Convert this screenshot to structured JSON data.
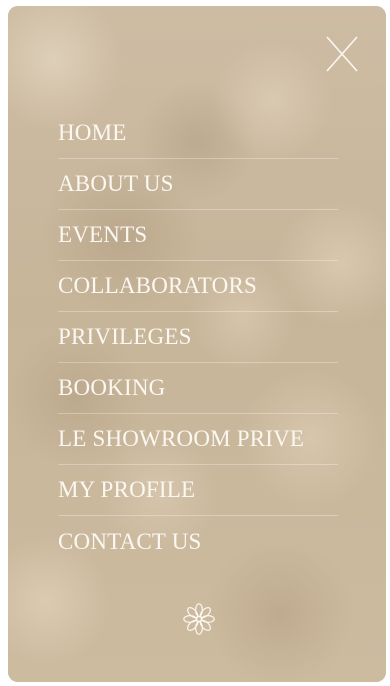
{
  "menu": {
    "items": [
      {
        "label": "HOME"
      },
      {
        "label": "ABOUT US"
      },
      {
        "label": "EVENTS"
      },
      {
        "label": "COLLABORATORS"
      },
      {
        "label": "PRIVILEGES"
      },
      {
        "label": "BOOKING"
      },
      {
        "label": "LE SHOWROOM PRIVE"
      },
      {
        "label": "MY PROFILE"
      },
      {
        "label": "CONTACT US"
      }
    ]
  },
  "icons": {
    "close": "close-icon",
    "logo": "flower-logo-icon"
  },
  "colors": {
    "background": "#cdbba1",
    "text": "#fbf7f1",
    "divider": "rgba(255,255,255,0.30)"
  }
}
